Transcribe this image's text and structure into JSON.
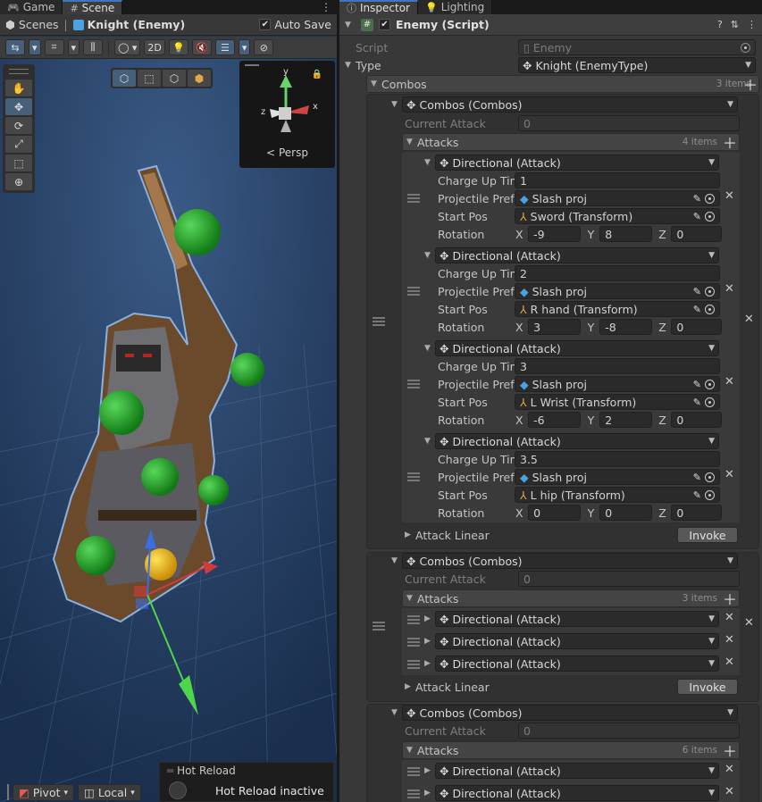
{
  "left_tabs": [
    "Game",
    "Scene"
  ],
  "scene_breadcrumb": {
    "root": "Scenes",
    "object": "Knight (Enemy)"
  },
  "auto_save_label": "Auto Save",
  "scene_toolbar": {
    "view_2d": "2D"
  },
  "gizmo": {
    "projection": "Persp",
    "axes": [
      "y",
      "z",
      "x"
    ]
  },
  "pivot_controls": {
    "pivot": "Pivot",
    "space": "Local"
  },
  "hot_reload": {
    "title": "Hot Reload",
    "status": "Hot Reload inactive"
  },
  "right_tabs": [
    "Inspector",
    "Lighting"
  ],
  "component": {
    "title": "Enemy (Script)"
  },
  "script": {
    "label": "Script",
    "value": "Enemy"
  },
  "type": {
    "label": "Type",
    "value": "Knight (EnemyType)"
  },
  "combos_label": "Combos",
  "combos_count": "3 items",
  "combo_title": "Combos (Combos)",
  "current_attack_label": "Current Attack",
  "current_attack_value": "0",
  "attacks_label": "Attacks",
  "attack_title": "Directional (Attack)",
  "labels": {
    "charge": "Charge Up Tim",
    "proj": "Projectile Prefa",
    "startpos": "Start Pos",
    "rotation": "Rotation",
    "x": "X",
    "y": "Y",
    "z": "Z"
  },
  "attack_linear_label": "Attack Linear",
  "invoke_label": "Invoke",
  "combo1": {
    "attacks_count": "4 items",
    "attacks": [
      {
        "charge": "1",
        "projectile": "Slash proj",
        "start_pos": "Sword (Transform)",
        "rx": "-9",
        "ry": "8",
        "rz": "0"
      },
      {
        "charge": "2",
        "projectile": "Slash proj",
        "start_pos": "R hand (Transform)",
        "rx": "3",
        "ry": "-8",
        "rz": "0"
      },
      {
        "charge": "3",
        "projectile": "Slash proj",
        "start_pos": "L Wrist (Transform)",
        "rx": "-6",
        "ry": "2",
        "rz": "0"
      },
      {
        "charge": "3.5",
        "projectile": "Slash proj",
        "start_pos": "L hip (Transform)",
        "rx": "0",
        "ry": "0",
        "rz": "0"
      }
    ]
  },
  "combo2": {
    "attacks_count": "3 items"
  },
  "combo3": {
    "attacks_count": "6 items"
  },
  "colors": {
    "scene_bg": "#1f3656",
    "accent": "#3a79bb",
    "inspector_bg": "#383838"
  }
}
